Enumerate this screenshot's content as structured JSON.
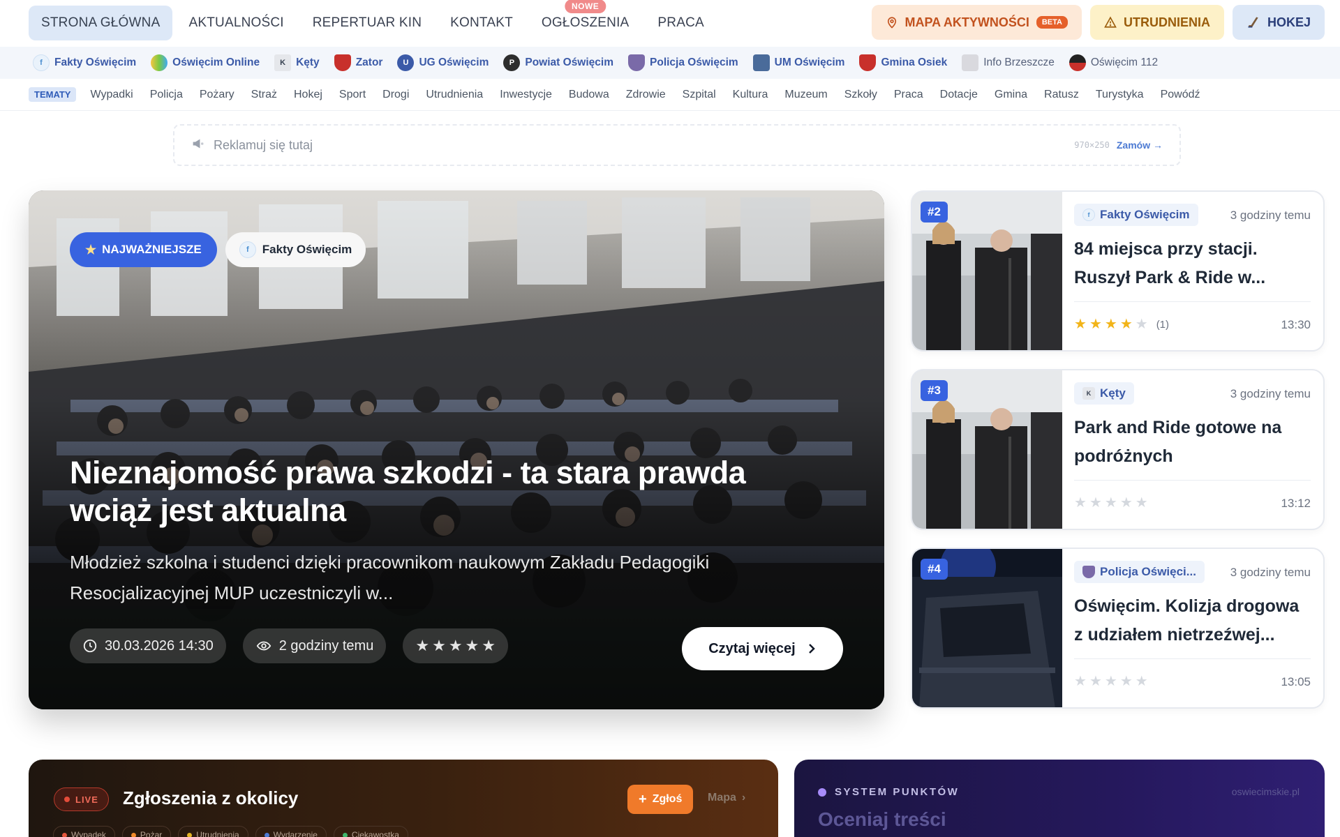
{
  "nav": {
    "links": [
      {
        "label": "STRONA GŁÓWNA"
      },
      {
        "label": "AKTUALNOŚCI"
      },
      {
        "label": "REPERTUAR KIN"
      },
      {
        "label": "KONTAKT"
      },
      {
        "label": "OGŁOSZENIA",
        "badge": "NOWE"
      },
      {
        "label": "PRACA"
      }
    ],
    "map_label": "MAPA AKTYWNOŚCI",
    "map_badge": "BETA",
    "disruptions_label": "UTRUDNIENIA",
    "hockey_label": "HOKEJ"
  },
  "sources": [
    "Fakty Oświęcim",
    "Oświęcim Online",
    "Kęty",
    "Zator",
    "UG Oświęcim",
    "Powiat Oświęcim",
    "Policja Oświęcim",
    "UM Oświęcim",
    "Gmina Osiek",
    "Info Brzeszcze",
    "Oświęcim 112"
  ],
  "topics": {
    "label": "TEMATY",
    "items": [
      "Wypadki",
      "Policja",
      "Pożary",
      "Straż",
      "Hokej",
      "Sport",
      "Drogi",
      "Utrudnienia",
      "Inwestycje",
      "Budowa",
      "Zdrowie",
      "Szpital",
      "Kultura",
      "Muzeum",
      "Szkoły",
      "Praca",
      "Dotacje",
      "Gmina",
      "Ratusz",
      "Turystyka",
      "Powódź"
    ]
  },
  "ad": {
    "text": "Reklamuj się tutaj",
    "size": "970×250",
    "order": "Zamów →"
  },
  "hero": {
    "tag": "NAJWAŻNIEJSZE",
    "source": "Fakty Oświęcim",
    "title": "Nieznajomość prawa szkodzi - ta stara prawda wciąż jest aktualna",
    "description": "Młodzież szkolna i studenci dzięki pracownikom naukowym Zakładu Pedagogiki Resocjalizacyjnej MUP uczestniczyli w...",
    "date": "30.03.2026 14:30",
    "ago": "2 godziny temu",
    "rating": 0,
    "read_more": "Czytaj więcej"
  },
  "cards": [
    {
      "rank": "#2",
      "source": "Fakty Oświęcim",
      "ago": "3 godziny temu",
      "title": "84 miejsca przy stacji. Ruszył Park & Ride w...",
      "rating": 4,
      "count": "(1)",
      "time": "13:30"
    },
    {
      "rank": "#3",
      "source": "Kęty",
      "ago": "3 godziny temu",
      "title": "Park and Ride gotowe na podróżnych",
      "rating": 0,
      "count": "",
      "time": "13:12"
    },
    {
      "rank": "#4",
      "source": "Policja Oświęci...",
      "ago": "3 godziny temu",
      "title": "Oświęcim. Kolizja drogowa z udziałem nietrzeźwej...",
      "rating": 0,
      "count": "",
      "time": "13:05"
    }
  ],
  "live": {
    "badge": "LIVE",
    "title": "Zgłoszenia z okolicy",
    "report": "Zgłoś",
    "map": "Mapa",
    "categories": [
      {
        "label": "Wypadek",
        "color": "#e4573d"
      },
      {
        "label": "Pożar",
        "color": "#f08a2a"
      },
      {
        "label": "Utrudnienia",
        "color": "#e3b424"
      },
      {
        "label": "Wydarzenie",
        "color": "#4c7ad3"
      },
      {
        "label": "Ciekawostka",
        "color": "#3fb66b"
      }
    ]
  },
  "points": {
    "label": "SYSTEM PUNKTÓW",
    "domain": "oswiecimskie.pl",
    "title": "Oceniaj treści"
  },
  "colors": {
    "accent": "#3863e0",
    "live": "#e4573d",
    "report": "#f07a2a",
    "star": "#f2b418"
  }
}
